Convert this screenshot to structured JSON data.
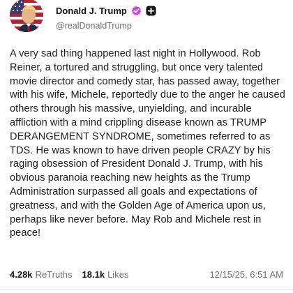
{
  "author": {
    "display_name": "Donald J. Trump",
    "handle": "@realDonaldTrump",
    "verified_color": "#c74bd6"
  },
  "post": {
    "text": "A very sad thing happened last night in Hollywood. Rob Reiner, a tortured and struggling, but once very talented movie director and comedy star, has passed away, together with his wife, Michele, reportedly due to the anger he caused others through his massive, unyielding, and incurable affliction with a mind crippling disease known as TRUMP DERANGEMENT SYNDROME, sometimes referred to as TDS. He was known to have driven people CRAZY by his raging obsession of President Donald J. Trump, with his obvious paranoia reaching new heights as the Trump Administration surpassed all goals and expectations of greatness, and with the Golden Age of America upon us, perhaps like never before. May Rob and Michele rest in peace!"
  },
  "stats": {
    "retruths_value": "4.28k",
    "retruths_label": "ReTruths",
    "likes_value": "18.1k",
    "likes_label": "Likes",
    "timestamp": "12/15/25, 6:51 AM"
  },
  "icons": {
    "verified": "verified-badge-icon",
    "plus": "plus-box-icon",
    "avatar": "profile-avatar"
  }
}
